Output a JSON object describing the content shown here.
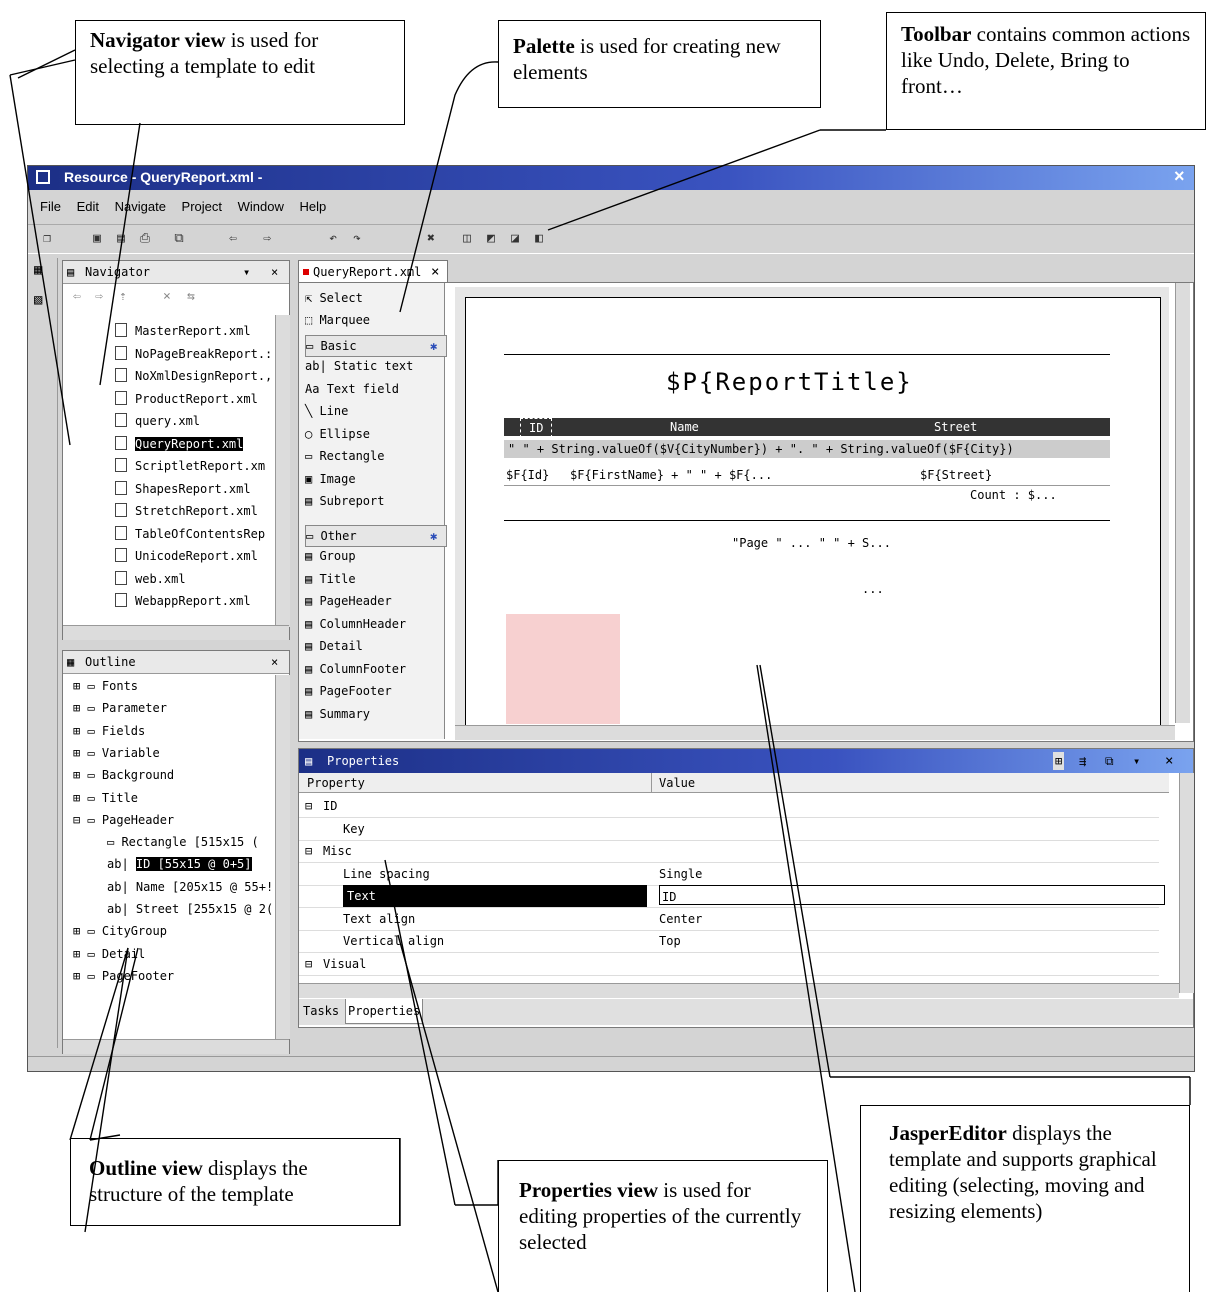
{
  "callouts": {
    "navigator": {
      "title": "Navigator view",
      "text": " is used for selecting a template to edit"
    },
    "palette": {
      "title": "Palette",
      "text": " is used for creating new elements"
    },
    "toolbar": {
      "title": "Toolbar",
      "text": " contains common actions like Undo, Delete, Bring to front…"
    },
    "outline": {
      "title": "Outline view",
      "text": " displays the structure of the template"
    },
    "properties": {
      "title": "Properties view",
      "text": " is used for editing properties of the currently selected"
    },
    "editor": {
      "title": "JasperEditor",
      "text": " displays the template and supports graphical editing (selecting, moving and resizing elements)"
    }
  },
  "window": {
    "title": "Resource - QueryReport.xml -",
    "close": "×",
    "menu": [
      "File",
      "Edit",
      "Navigate",
      "Project",
      "Window",
      "Help"
    ]
  },
  "navigator": {
    "title": "Navigator",
    "files": [
      "MasterReport.xml",
      "NoPageBreakReport.:",
      "NoXmlDesignReport.,",
      "ProductReport.xml",
      "query.xml",
      "QueryReport.xml",
      "ScriptletReport.xm",
      "ShapesReport.xml",
      "StretchReport.xml",
      "TableOfContentsRep",
      "UnicodeReport.xml",
      "web.xml",
      "WebappReport.xml"
    ],
    "selected_index": 5
  },
  "outline": {
    "title": "Outline",
    "items": [
      "Fonts",
      "Parameter",
      "Fields",
      "Variable",
      "Background",
      "Title",
      "PageHeader"
    ],
    "children": [
      "Rectangle [515x15 (",
      "ID [55x15 @ 0+5]",
      "Name [205x15 @ 55+!",
      "Street [255x15 @ 2("
    ],
    "after": [
      "CityGroup",
      "Detail",
      "PageFooter"
    ]
  },
  "editor": {
    "tab": "QueryReport.xml",
    "title": "$P{ReportTitle}",
    "header": {
      "id": "ID",
      "name": "Name",
      "street": "Street"
    },
    "group": "\"  \" + String.valueOf($V{CityNumber}) + \". \" + String.valueOf($F{City})",
    "detail": {
      "id": "$F{Id}",
      "name": "$F{FirstName} + \" \" + $F{...",
      "street": "$F{Street}"
    },
    "count": "Count : $...",
    "page": "\"Page \" ... \" \" + S...",
    "ellipsis": "..."
  },
  "palette": {
    "select": "Select",
    "marquee": "Marquee",
    "basic": "Basic",
    "basic_items": [
      "Static text",
      "Text field",
      "Line",
      "Ellipse",
      "Rectangle",
      "Image",
      "Subreport"
    ],
    "other": "Other",
    "other_items": [
      "Group",
      "Title",
      "PageHeader",
      "ColumnHeader",
      "Detail",
      "ColumnFooter",
      "PageFooter",
      "Summary"
    ]
  },
  "properties": {
    "title": "Properties",
    "col_property": "Property",
    "col_value": "Value",
    "rows": [
      {
        "p": "ID",
        "v": "",
        "cat": true
      },
      {
        "p": "Key",
        "v": "",
        "cat": false
      },
      {
        "p": "Misc",
        "v": "",
        "cat": true
      },
      {
        "p": "Line spacing",
        "v": "Single",
        "cat": false
      },
      {
        "p": "Text",
        "v": "ID",
        "cat": false,
        "selected": true
      },
      {
        "p": "Text align",
        "v": "Center",
        "cat": false
      },
      {
        "p": "Vertical align",
        "v": "Top",
        "cat": false
      },
      {
        "p": "Visual",
        "v": "",
        "cat": true
      }
    ],
    "tabs": [
      "Tasks",
      "Properties"
    ]
  }
}
